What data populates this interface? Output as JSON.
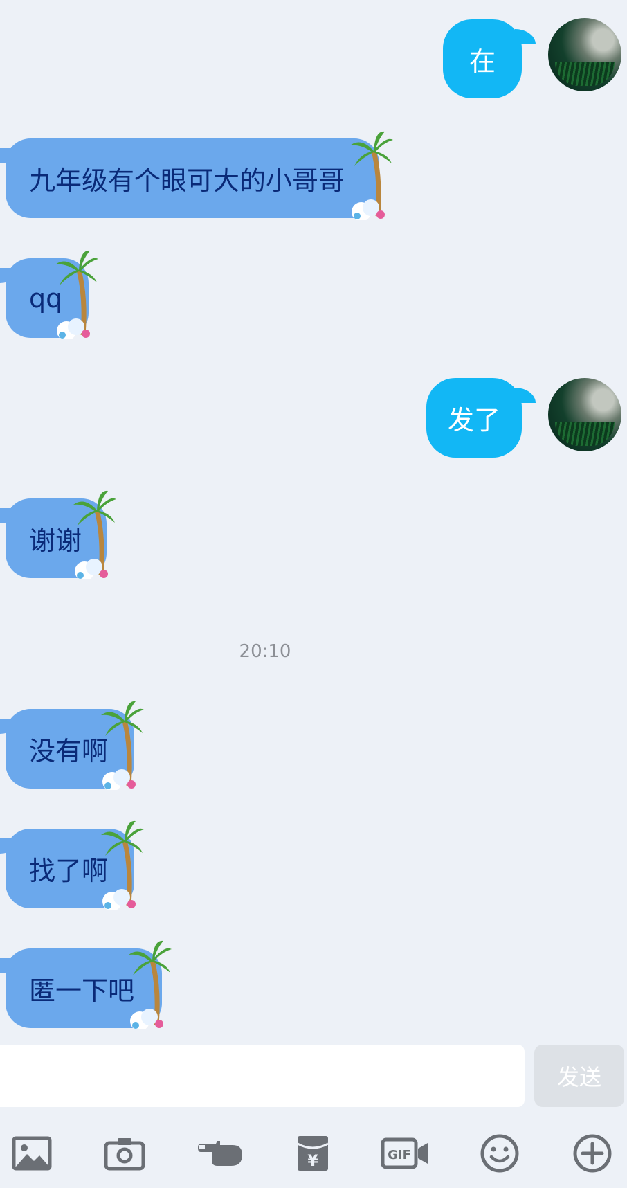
{
  "messages": {
    "out_1": "在",
    "in_1": "九年级有个眼可大的小哥哥",
    "in_2": "qq",
    "out_2": "发了",
    "in_3": "谢谢",
    "timestamp": "20:10",
    "in_4": "没有啊",
    "in_5": "找了啊",
    "in_6": "匿一下吧"
  },
  "composer": {
    "input_value": "",
    "send_label": "发送"
  },
  "toolbar": {
    "icons": [
      "image-icon",
      "camera-icon",
      "poke-icon",
      "red-packet-icon",
      "gif-icon",
      "emoji-icon",
      "plus-icon"
    ],
    "gif_text": "GIF",
    "red_packet_symbol": "¥"
  },
  "colors": {
    "background": "#edf1f7",
    "outgoing_bubble": "#12b7f5",
    "incoming_bubble": "#6ba8ec",
    "incoming_text": "#0a2a78",
    "icon_gray": "#6b6f75"
  }
}
